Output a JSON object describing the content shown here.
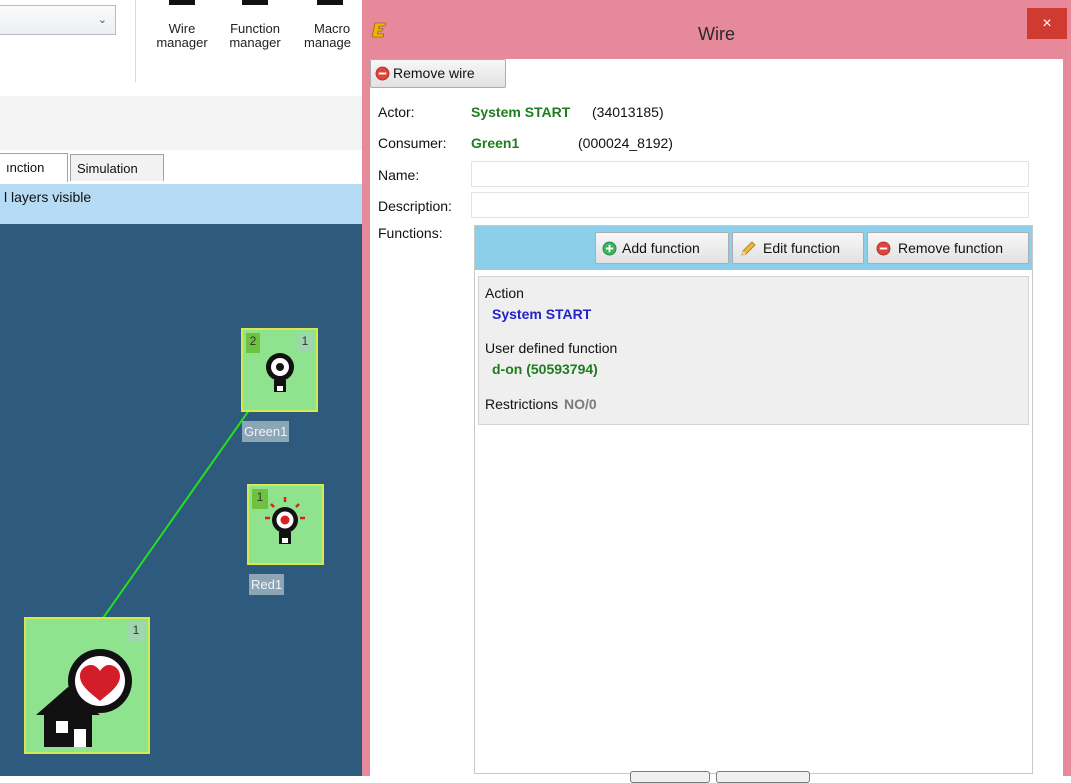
{
  "ribbon": {
    "buttons": [
      {
        "line1": "Wire",
        "line2": "manager"
      },
      {
        "line1": "Function",
        "line2": "manager"
      },
      {
        "line1": "Macro",
        "line2": "manage"
      }
    ]
  },
  "tabs": [
    {
      "label": "ınction",
      "active": true
    },
    {
      "label": "Simulation",
      "active": false
    }
  ],
  "layer_status": "l layers visible",
  "canvas": {
    "nodes": [
      {
        "name": "Green1",
        "badges": [
          "2",
          "1"
        ]
      },
      {
        "name": "Red1",
        "badges": [
          "1"
        ]
      },
      {
        "name": "",
        "badges": [
          "1"
        ]
      }
    ]
  },
  "dialog": {
    "title": "Wire",
    "close_label": "×",
    "remove_wire_label": "Remove wire",
    "labels": {
      "actor": "Actor:",
      "consumer": "Consumer:",
      "name": "Name:",
      "description": "Description:",
      "functions": "Functions:"
    },
    "actor_name": "System START",
    "actor_id": "(34013185)",
    "consumer_name": "Green1",
    "consumer_id": "(000024_8192)",
    "name_value": "",
    "description_value": "",
    "function_buttons": {
      "add": "Add function",
      "edit": "Edit function",
      "remove": "Remove function"
    },
    "function_item": {
      "action_label": "Action",
      "action_value": "System START",
      "udf_label": "User defined function",
      "udf_value": "d-on (50593794)",
      "restrictions_label": "Restrictions",
      "restrictions_value": "NO/0"
    }
  },
  "colors": {
    "dialog_frame": "#e6899a",
    "close_button": "#cf3b30",
    "canvas_bg": "#2e5a7d",
    "layer_bar": "#b6dbf4",
    "node_fill": "#8fe38e",
    "wire_line": "#22e022",
    "functions_header": "#8ccfea",
    "green_text": "#1f7d1f",
    "blue_text": "#2222cc"
  },
  "icons": [
    "app-logo-icon",
    "remove-circle-icon",
    "add-circle-icon",
    "pencil-icon",
    "light-bulb-icon",
    "light-bulb-red-icon",
    "house-heart-icon",
    "chevron-down-icon"
  ]
}
